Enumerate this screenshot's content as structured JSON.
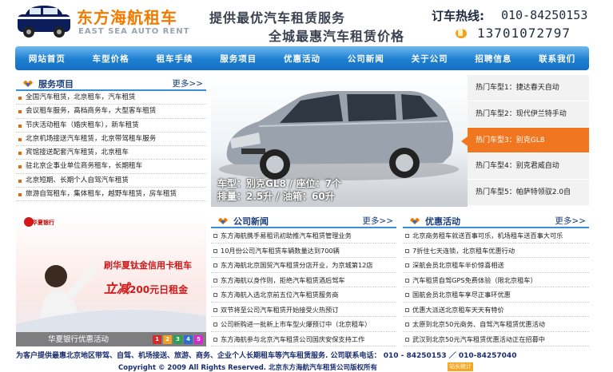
{
  "header": {
    "logo_cn": "东方海航租车",
    "logo_en": "EAST SEA AUTO RENT",
    "slogan1": "提供最优汽车租赁服务",
    "slogan2": "全城最惠汽车租赁价格",
    "hotline_label": "订车热线:",
    "hotline_number": "010-84250153",
    "mobile_number": "13701072797"
  },
  "nav": [
    "网站首页",
    "车型价格",
    "租车手续",
    "服务项目",
    "优惠活动",
    "公司新闻",
    "关于公司",
    "招聘信息",
    "联系我们"
  ],
  "services": {
    "title": "服务项目",
    "more": "更多>>",
    "items": [
      "全国汽车租赁，北京租车，汽车租赁",
      "会议租车服务，高档商务车，大型客车租赁",
      "节庆活动租车（婚庆租车），新车租赁",
      "北京机场接送汽车租赁，北京带驾租车服务",
      "宾馆接送配套汽车租赁，北京租车",
      "驻北京企事业单位商务租车，长期租车",
      "北京短期、长期个人自驾汽车租赁",
      "旅游自驾租车，集体租车，越野车租赁，房车租赁"
    ]
  },
  "hero": {
    "caption_line1": "车型：别克GL8 / 座位：7个",
    "caption_line2": "排量：2.5升 / 油箱：60升"
  },
  "hot_cars": {
    "active_index": 2,
    "items": [
      "热门车型1：捷达春天自动",
      "热门车型2：现代伊兰特手动",
      "热门车型3：别克GL8",
      "热门车型4：别克君威自动",
      "热门车型5：帕萨特领驭2.0自"
    ]
  },
  "ad": {
    "bank": "华夏银行",
    "line1": "刷华夏钛金信用卡租车",
    "line2": "200元日租金",
    "line2_prefix": "立减",
    "caption": "华夏银行优惠活动",
    "pages": [
      "1",
      "2",
      "3",
      "4",
      "5"
    ],
    "page_colors": [
      "#d62a2a",
      "#f0a020",
      "#2aa050",
      "#2a70d0",
      "#d62ad0"
    ]
  },
  "news": {
    "title": "公司新闻",
    "more": "更多>>",
    "items": [
      "东方海航携手易租讯初助推汽车租赁管理业务",
      "10月份公司汽车租赁车辆数量达到700辆",
      "东方海航北京国贸汽车租赁分店开业，为京城第12店",
      "东方海航以身作则，拒绝汽车租赁酒后驾车",
      "东方海航入选北京前五位汽车租赁服务商",
      "双节将至公司汽车租赁开始接受火热预订",
      "公司新购进一批新上市车型火爆预订中（北京租车）",
      "东方海航参与北京汽车租赁公司国庆安保支持工作"
    ]
  },
  "promos": {
    "title": "优惠活动",
    "more": "更多>>",
    "items": [
      "北京商务租车就送百事可乐，机场租车送百事大可乐",
      "7折住七天连锁，北京租车优惠行动",
      "深航会员北京租车半价惊喜相送",
      "汽车租赁自驾GPS免费体验（限北京租车）",
      "国航会员北京租车享尽正事环优惠",
      "优惠大派送北京租车天天有特价",
      "太原到北京50元商务、自驾汽车租赁优惠活动",
      "武汉到北京50元汽车租赁优惠活动正在招募中"
    ]
  },
  "footer": {
    "line1": "为客户提供最惠北京地区带驾、自驾、机场接送、旅游、商务、企业个人长期租车等汽车租赁服务. 公司联系电话： 010 - 84250153 ／ 010-84257040",
    "line2": "Copyright © 2009 All Rights Reserved. 北京东方海航汽车租赁公司版权所有",
    "badge": "站长统计"
  },
  "colors": {
    "brand_orange": "#f07b00",
    "nav_blue": "#1d7fd1",
    "accent_orange": "#f07620",
    "footer_text": "#1a2d70"
  }
}
